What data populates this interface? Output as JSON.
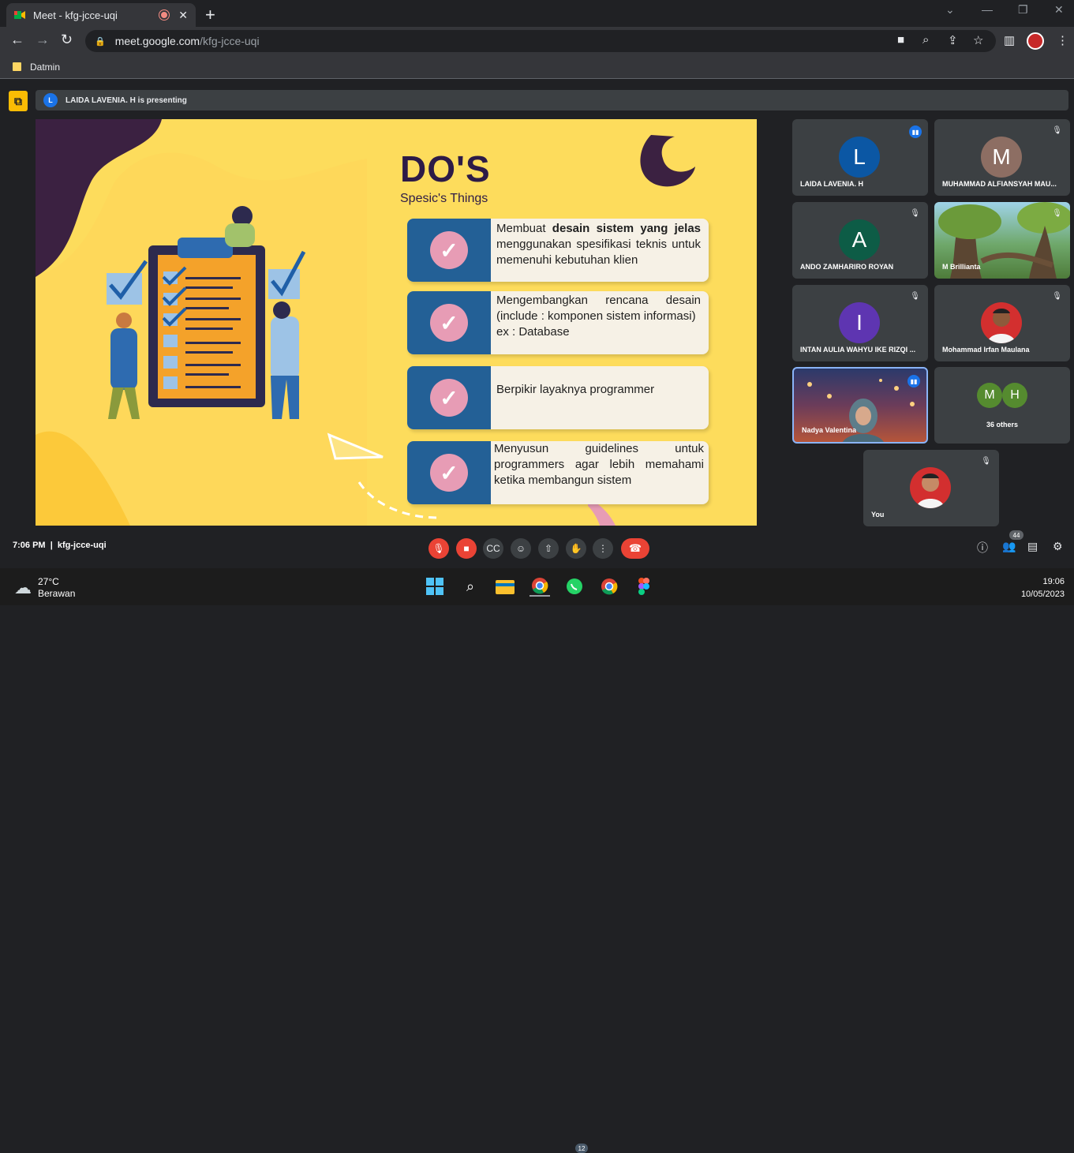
{
  "browser": {
    "tab_title": "Meet - kfg-jcce-uqi",
    "tab_close": "✕",
    "new_tab": "+",
    "url_host": "meet.google.com",
    "url_path": "/kfg-jcce-uqi",
    "bookmark": "Datmin"
  },
  "meet": {
    "presenter_initial": "L",
    "presenting_text": "LAIDA LAVENIA. H is presenting",
    "time": "7:06 PM",
    "meeting_code": "kfg-jcce-uqi",
    "people_count": "44"
  },
  "slide": {
    "title": "DO'S",
    "subtitle": "Spesic's Things",
    "cards": [
      {
        "pre": "Membuat ",
        "bold": "desain sistem yang jelas",
        "post": " menggunakan spesifikasi teknis untuk memenuhi kebutuhan klien"
      },
      {
        "pre": "Mengembangkan rencana desain (include : komponen sistem informasi)",
        "bold": "",
        "post": "ex : Database"
      },
      {
        "pre": "Berpikir layaknya programmer",
        "bold": "",
        "post": ""
      },
      {
        "pre": "Menyusun guidelines untuk programmers agar lebih memahami ketika membangun sistem",
        "bold": "",
        "post": ""
      }
    ]
  },
  "participants": [
    {
      "initial": "L",
      "name": "LAIDA LAVENIA. H",
      "color": "#0b57a4"
    },
    {
      "initial": "M",
      "name": "MUHAMMAD ALFIANSYAH MAU...",
      "color": "#8d6e63"
    },
    {
      "initial": "A",
      "name": "ANDO ZAMHARIRO ROYAN",
      "color": "#0d5c46"
    },
    {
      "initial": "",
      "name": "M Brillianta",
      "color": ""
    },
    {
      "initial": "I",
      "name": "INTAN AULIA WAHYU IKE RIZQI ...",
      "color": "#5e35b1"
    },
    {
      "initial": "",
      "name": "Mohammad Irfan Maulana",
      "color": ""
    },
    {
      "initial": "",
      "name": "Nadya Valentina",
      "color": ""
    },
    {
      "initial": "M",
      "initial2": "H",
      "name": "36 others",
      "color": "#558b2f"
    },
    {
      "initial": "",
      "name": "You",
      "color": ""
    }
  ],
  "taskbar": {
    "temperature": "27°C",
    "weather": "Berawan",
    "whatsapp_badge": "12",
    "clock_time": "19:06",
    "clock_date": "10/05/2023"
  }
}
